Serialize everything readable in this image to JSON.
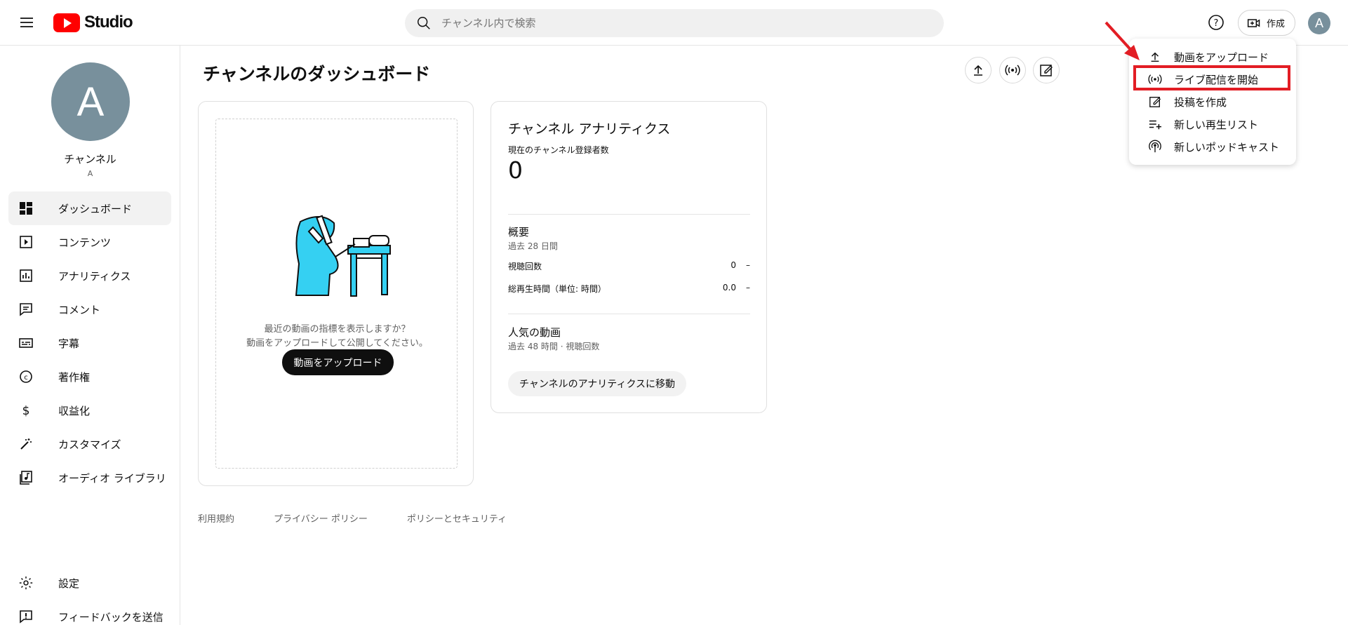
{
  "header": {
    "logo_text": "Studio",
    "search_placeholder": "チャンネル内で検索",
    "create_label": "作成",
    "avatar_letter": "A"
  },
  "sidebar": {
    "channel_avatar_letter": "A",
    "channel_name": "チャンネル",
    "channel_handle": "A",
    "items": [
      {
        "label": "ダッシュボード",
        "icon": "dashboard-icon",
        "active": true
      },
      {
        "label": "コンテンツ",
        "icon": "content-icon"
      },
      {
        "label": "アナリティクス",
        "icon": "analytics-icon"
      },
      {
        "label": "コメント",
        "icon": "comment-icon"
      },
      {
        "label": "字幕",
        "icon": "subtitles-icon"
      },
      {
        "label": "著作権",
        "icon": "copyright-icon"
      },
      {
        "label": "収益化",
        "icon": "monetization-icon"
      },
      {
        "label": "カスタマイズ",
        "icon": "customize-icon"
      },
      {
        "label": "オーディオ ライブラリ",
        "icon": "audio-library-icon"
      }
    ],
    "settings_label": "設定",
    "feedback_label": "フィードバックを送信"
  },
  "main": {
    "page_title": "チャンネルのダッシュボード",
    "upload_card": {
      "prompt_line1": "最近の動画の指標を表示しますか？",
      "prompt_line2": "動画をアップロードして公開してください。",
      "button_label": "動画をアップロード"
    },
    "analytics_card": {
      "title": "チャンネル アナリティクス",
      "subscribers_label": "現在のチャンネル登録者数",
      "subscribers_value": "0",
      "summary_title": "概要",
      "summary_period": "過去 28 日間",
      "rows": [
        {
          "label": "視聴回数",
          "value": "0",
          "trend": "–"
        },
        {
          "label": "総再生時間（単位: 時間）",
          "value": "0.0",
          "trend": "–"
        }
      ],
      "popular_title": "人気の動画",
      "popular_period": "過去 48 時間 · 視聴回数",
      "link_label": "チャンネルのアナリティクスに移動"
    },
    "footer_links": [
      "利用規約",
      "プライバシー ポリシー",
      "ポリシーとセキュリティ"
    ]
  },
  "menu": {
    "items": [
      {
        "label": "動画をアップロード",
        "icon": "upload-icon"
      },
      {
        "label": "ライブ配信を開始",
        "icon": "live-icon",
        "highlighted": true
      },
      {
        "label": "投稿を作成",
        "icon": "edit-post-icon"
      },
      {
        "label": "新しい再生リスト",
        "icon": "playlist-add-icon"
      },
      {
        "label": "新しいポッドキャスト",
        "icon": "podcast-icon"
      }
    ]
  },
  "colors": {
    "accent_red": "#e21d24",
    "youtube_red": "#ff0000",
    "avatar_gray": "#78909c",
    "illustration_cyan": "#35d0f2"
  }
}
